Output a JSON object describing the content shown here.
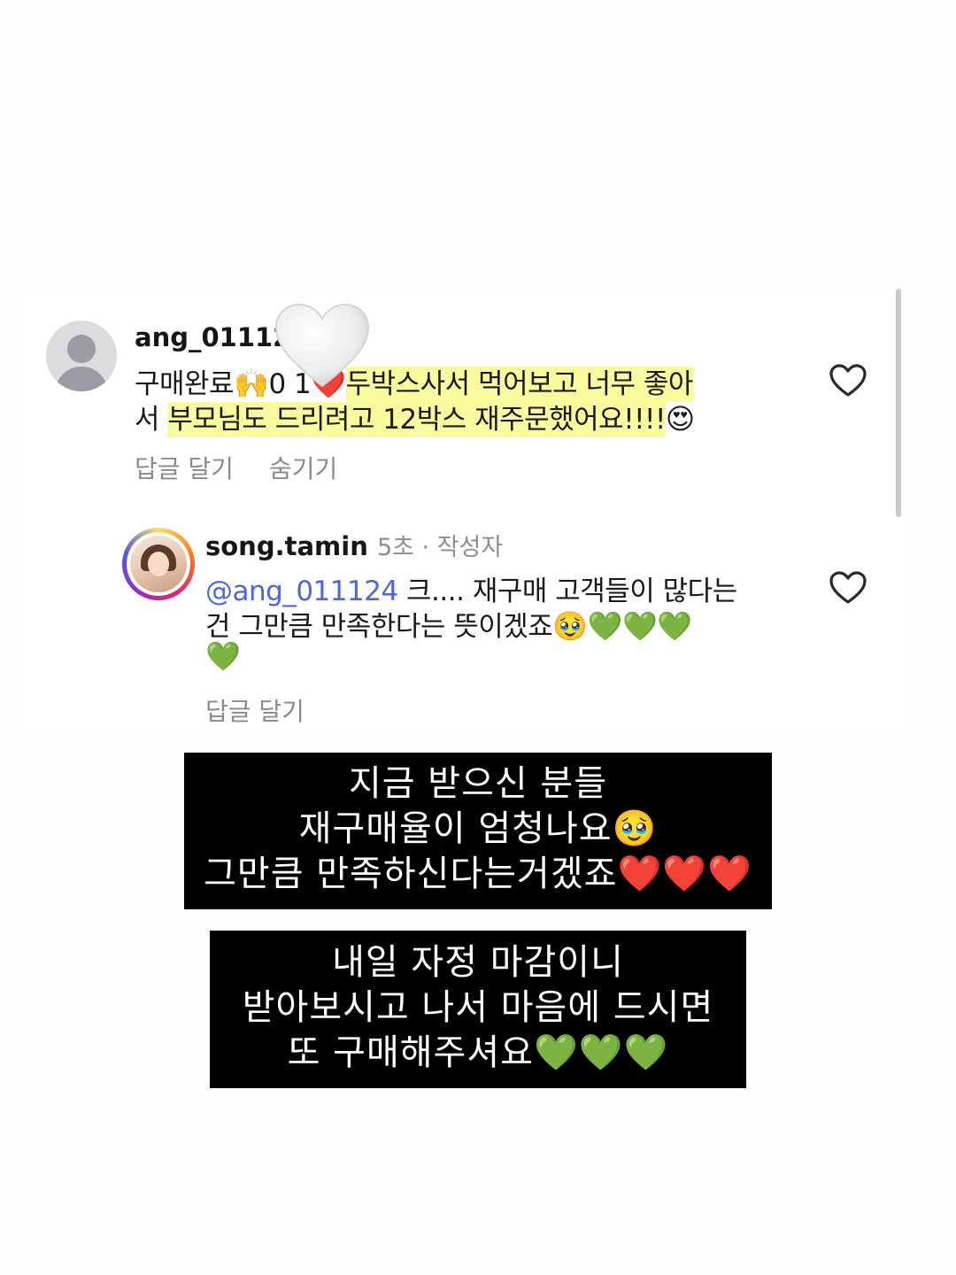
{
  "comment1": {
    "username": "ang_01112",
    "line1_plain": "구매완료",
    "line1_emoji1": "🙌",
    "line1_partial": "0 1",
    "line1_heart": "❤️",
    "line1_highlight": "두박스사서 먹어보고 너무 좋아",
    "line2_start": "서 ",
    "line2_highlight": "부모님도 드리려고 12박스 재주문했어요!!!!",
    "line2_emoji": "😍",
    "reply_label": "답글 달기",
    "hide_label": "숨기기"
  },
  "comment2": {
    "username": "song.tamin",
    "meta": "5초 · 작성자",
    "mention": "@ang_011124",
    "line1_rest": " 크.... 재구매 고객들이 많다는",
    "line2": "건 그만큼 만족한다는 뜻이겠죠",
    "line2_emojis": "🥹💚💚💚",
    "line3_emoji": "💚",
    "reply_label": "답글 달기"
  },
  "overlay1": {
    "row1": "지금  받으신  분들",
    "row2": "재구매율이  엄청나요",
    "row2_emoji": "🥹",
    "row3": "그만큼  만족하신다는거겠죠",
    "row3_emoji": "❤️❤️❤️"
  },
  "overlay2": {
    "row1": "내일  자정  마감이니",
    "row2": "받아보시고  나서  마음에  드시면",
    "row3": "또  구매해주셔요",
    "row3_emoji": "💚💚💚"
  },
  "icons": {
    "like_icon": "heart-outline-icon",
    "decor_icon": "white-heart-icon"
  }
}
